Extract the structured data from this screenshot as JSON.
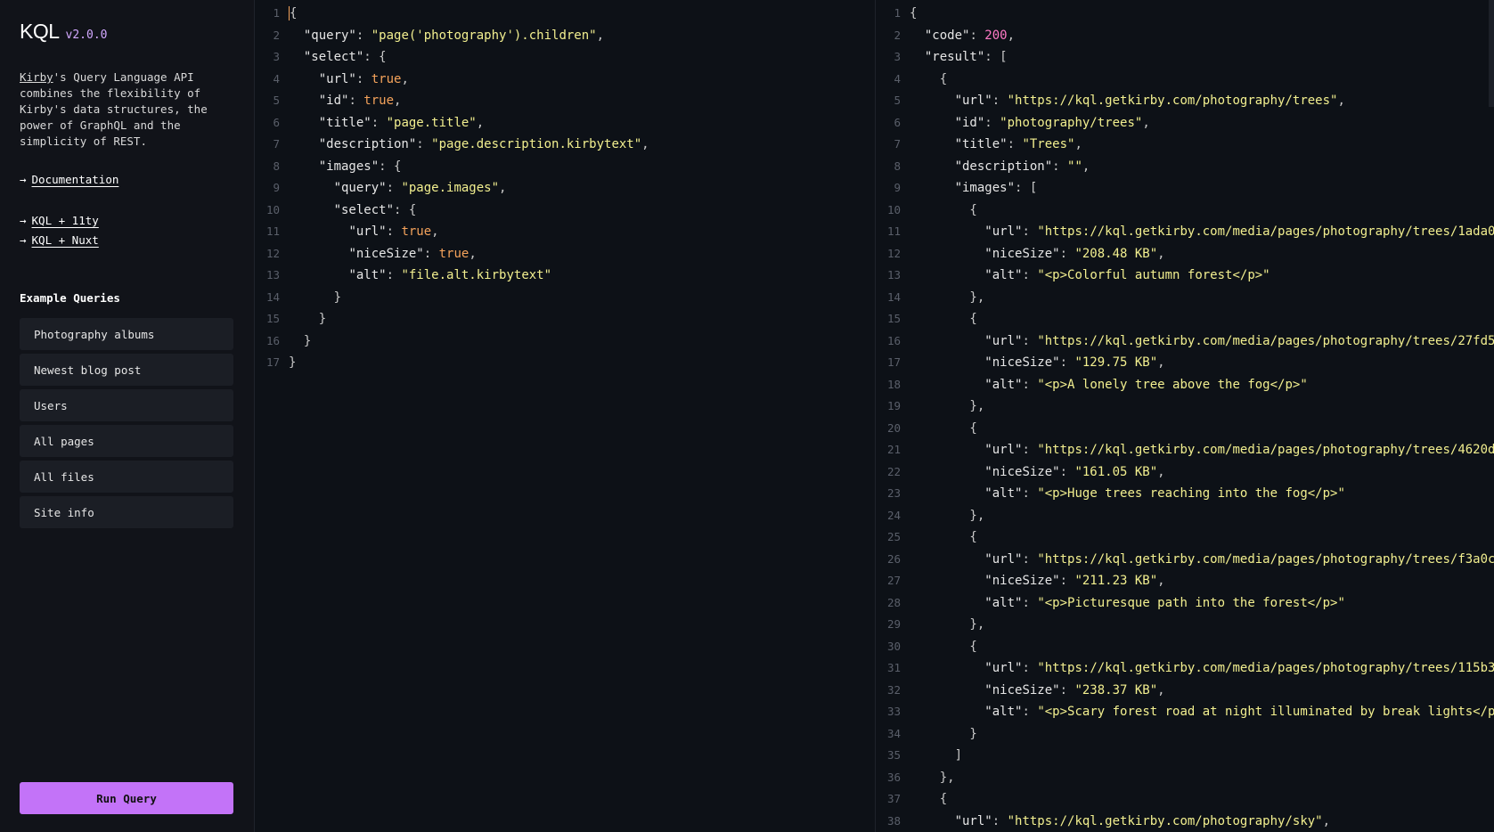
{
  "sidebar": {
    "brand_name": "KQL",
    "version": "v2.0.0",
    "intro_link": "Kirby",
    "intro_text": "'s Query Language API combines the flexibility of Kirby's data structures, the power of GraphQL and the simplicity of REST.",
    "links": [
      {
        "arrow": "→",
        "label": "Documentation"
      },
      {
        "arrow": "→",
        "label": "KQL + 11ty"
      },
      {
        "arrow": "→",
        "label": "KQL + Nuxt"
      }
    ],
    "examples_title": "Example Queries",
    "examples": [
      {
        "label": "Photography albums"
      },
      {
        "label": "Newest blog post"
      },
      {
        "label": "Users"
      },
      {
        "label": "All pages"
      },
      {
        "label": "All files"
      },
      {
        "label": "Site info"
      }
    ],
    "run_label": "Run Query"
  },
  "query_lines": [
    [
      {
        "t": "p",
        "v": "{"
      }
    ],
    [
      {
        "t": "p",
        "v": "  "
      },
      {
        "t": "k",
        "v": "\"query\""
      },
      {
        "t": "p",
        "v": ": "
      },
      {
        "t": "s",
        "v": "\"page('photography').children\""
      },
      {
        "t": "p",
        "v": ","
      }
    ],
    [
      {
        "t": "p",
        "v": "  "
      },
      {
        "t": "k",
        "v": "\"select\""
      },
      {
        "t": "p",
        "v": ": {"
      }
    ],
    [
      {
        "t": "p",
        "v": "    "
      },
      {
        "t": "k",
        "v": "\"url\""
      },
      {
        "t": "p",
        "v": ": "
      },
      {
        "t": "b",
        "v": "true"
      },
      {
        "t": "p",
        "v": ","
      }
    ],
    [
      {
        "t": "p",
        "v": "    "
      },
      {
        "t": "k",
        "v": "\"id\""
      },
      {
        "t": "p",
        "v": ": "
      },
      {
        "t": "b",
        "v": "true"
      },
      {
        "t": "p",
        "v": ","
      }
    ],
    [
      {
        "t": "p",
        "v": "    "
      },
      {
        "t": "k",
        "v": "\"title\""
      },
      {
        "t": "p",
        "v": ": "
      },
      {
        "t": "s",
        "v": "\"page.title\""
      },
      {
        "t": "p",
        "v": ","
      }
    ],
    [
      {
        "t": "p",
        "v": "    "
      },
      {
        "t": "k",
        "v": "\"description\""
      },
      {
        "t": "p",
        "v": ": "
      },
      {
        "t": "s",
        "v": "\"page.description.kirbytext\""
      },
      {
        "t": "p",
        "v": ","
      }
    ],
    [
      {
        "t": "p",
        "v": "    "
      },
      {
        "t": "k",
        "v": "\"images\""
      },
      {
        "t": "p",
        "v": ": {"
      }
    ],
    [
      {
        "t": "p",
        "v": "      "
      },
      {
        "t": "k",
        "v": "\"query\""
      },
      {
        "t": "p",
        "v": ": "
      },
      {
        "t": "s",
        "v": "\"page.images\""
      },
      {
        "t": "p",
        "v": ","
      }
    ],
    [
      {
        "t": "p",
        "v": "      "
      },
      {
        "t": "k",
        "v": "\"select\""
      },
      {
        "t": "p",
        "v": ": {"
      }
    ],
    [
      {
        "t": "p",
        "v": "        "
      },
      {
        "t": "k",
        "v": "\"url\""
      },
      {
        "t": "p",
        "v": ": "
      },
      {
        "t": "b",
        "v": "true"
      },
      {
        "t": "p",
        "v": ","
      }
    ],
    [
      {
        "t": "p",
        "v": "        "
      },
      {
        "t": "k",
        "v": "\"niceSize\""
      },
      {
        "t": "p",
        "v": ": "
      },
      {
        "t": "b",
        "v": "true"
      },
      {
        "t": "p",
        "v": ","
      }
    ],
    [
      {
        "t": "p",
        "v": "        "
      },
      {
        "t": "k",
        "v": "\"alt\""
      },
      {
        "t": "p",
        "v": ": "
      },
      {
        "t": "s",
        "v": "\"file.alt.kirbytext\""
      }
    ],
    [
      {
        "t": "p",
        "v": "      }"
      }
    ],
    [
      {
        "t": "p",
        "v": "    }"
      }
    ],
    [
      {
        "t": "p",
        "v": "  }"
      }
    ],
    [
      {
        "t": "p",
        "v": "}"
      }
    ]
  ],
  "result_lines": [
    [
      {
        "t": "p",
        "v": "{"
      }
    ],
    [
      {
        "t": "p",
        "v": "  "
      },
      {
        "t": "k",
        "v": "\"code\""
      },
      {
        "t": "p",
        "v": ": "
      },
      {
        "t": "n",
        "v": "200"
      },
      {
        "t": "p",
        "v": ","
      }
    ],
    [
      {
        "t": "p",
        "v": "  "
      },
      {
        "t": "k",
        "v": "\"result\""
      },
      {
        "t": "p",
        "v": ": ["
      }
    ],
    [
      {
        "t": "p",
        "v": "    {"
      }
    ],
    [
      {
        "t": "p",
        "v": "      "
      },
      {
        "t": "k",
        "v": "\"url\""
      },
      {
        "t": "p",
        "v": ": "
      },
      {
        "t": "s",
        "v": "\"https://kql.getkirby.com/photography/trees\""
      },
      {
        "t": "p",
        "v": ","
      }
    ],
    [
      {
        "t": "p",
        "v": "      "
      },
      {
        "t": "k",
        "v": "\"id\""
      },
      {
        "t": "p",
        "v": ": "
      },
      {
        "t": "s",
        "v": "\"photography/trees\""
      },
      {
        "t": "p",
        "v": ","
      }
    ],
    [
      {
        "t": "p",
        "v": "      "
      },
      {
        "t": "k",
        "v": "\"title\""
      },
      {
        "t": "p",
        "v": ": "
      },
      {
        "t": "s",
        "v": "\"Trees\""
      },
      {
        "t": "p",
        "v": ","
      }
    ],
    [
      {
        "t": "p",
        "v": "      "
      },
      {
        "t": "k",
        "v": "\"description\""
      },
      {
        "t": "p",
        "v": ": "
      },
      {
        "t": "s",
        "v": "\"\""
      },
      {
        "t": "p",
        "v": ","
      }
    ],
    [
      {
        "t": "p",
        "v": "      "
      },
      {
        "t": "k",
        "v": "\"images\""
      },
      {
        "t": "p",
        "v": ": ["
      }
    ],
    [
      {
        "t": "p",
        "v": "        {"
      }
    ],
    [
      {
        "t": "p",
        "v": "          "
      },
      {
        "t": "k",
        "v": "\"url\""
      },
      {
        "t": "p",
        "v": ": "
      },
      {
        "t": "s",
        "v": "\"https://kql.getkirby.com/media/pages/photography/trees/1ada0"
      }
    ],
    [
      {
        "t": "p",
        "v": "          "
      },
      {
        "t": "k",
        "v": "\"niceSize\""
      },
      {
        "t": "p",
        "v": ": "
      },
      {
        "t": "s",
        "v": "\"208.48 KB\""
      },
      {
        "t": "p",
        "v": ","
      }
    ],
    [
      {
        "t": "p",
        "v": "          "
      },
      {
        "t": "k",
        "v": "\"alt\""
      },
      {
        "t": "p",
        "v": ": "
      },
      {
        "t": "s",
        "v": "\"<p>Colorful autumn forest</p>\""
      }
    ],
    [
      {
        "t": "p",
        "v": "        },"
      }
    ],
    [
      {
        "t": "p",
        "v": "        {"
      }
    ],
    [
      {
        "t": "p",
        "v": "          "
      },
      {
        "t": "k",
        "v": "\"url\""
      },
      {
        "t": "p",
        "v": ": "
      },
      {
        "t": "s",
        "v": "\"https://kql.getkirby.com/media/pages/photography/trees/27fd5"
      }
    ],
    [
      {
        "t": "p",
        "v": "          "
      },
      {
        "t": "k",
        "v": "\"niceSize\""
      },
      {
        "t": "p",
        "v": ": "
      },
      {
        "t": "s",
        "v": "\"129.75 KB\""
      },
      {
        "t": "p",
        "v": ","
      }
    ],
    [
      {
        "t": "p",
        "v": "          "
      },
      {
        "t": "k",
        "v": "\"alt\""
      },
      {
        "t": "p",
        "v": ": "
      },
      {
        "t": "s",
        "v": "\"<p>A lonely tree above the fog</p>\""
      }
    ],
    [
      {
        "t": "p",
        "v": "        },"
      }
    ],
    [
      {
        "t": "p",
        "v": "        {"
      }
    ],
    [
      {
        "t": "p",
        "v": "          "
      },
      {
        "t": "k",
        "v": "\"url\""
      },
      {
        "t": "p",
        "v": ": "
      },
      {
        "t": "s",
        "v": "\"https://kql.getkirby.com/media/pages/photography/trees/4620d"
      }
    ],
    [
      {
        "t": "p",
        "v": "          "
      },
      {
        "t": "k",
        "v": "\"niceSize\""
      },
      {
        "t": "p",
        "v": ": "
      },
      {
        "t": "s",
        "v": "\"161.05 KB\""
      },
      {
        "t": "p",
        "v": ","
      }
    ],
    [
      {
        "t": "p",
        "v": "          "
      },
      {
        "t": "k",
        "v": "\"alt\""
      },
      {
        "t": "p",
        "v": ": "
      },
      {
        "t": "s",
        "v": "\"<p>Huge trees reaching into the fog</p>\""
      }
    ],
    [
      {
        "t": "p",
        "v": "        },"
      }
    ],
    [
      {
        "t": "p",
        "v": "        {"
      }
    ],
    [
      {
        "t": "p",
        "v": "          "
      },
      {
        "t": "k",
        "v": "\"url\""
      },
      {
        "t": "p",
        "v": ": "
      },
      {
        "t": "s",
        "v": "\"https://kql.getkirby.com/media/pages/photography/trees/f3a0c"
      }
    ],
    [
      {
        "t": "p",
        "v": "          "
      },
      {
        "t": "k",
        "v": "\"niceSize\""
      },
      {
        "t": "p",
        "v": ": "
      },
      {
        "t": "s",
        "v": "\"211.23 KB\""
      },
      {
        "t": "p",
        "v": ","
      }
    ],
    [
      {
        "t": "p",
        "v": "          "
      },
      {
        "t": "k",
        "v": "\"alt\""
      },
      {
        "t": "p",
        "v": ": "
      },
      {
        "t": "s",
        "v": "\"<p>Picturesque path into the forest</p>\""
      }
    ],
    [
      {
        "t": "p",
        "v": "        },"
      }
    ],
    [
      {
        "t": "p",
        "v": "        {"
      }
    ],
    [
      {
        "t": "p",
        "v": "          "
      },
      {
        "t": "k",
        "v": "\"url\""
      },
      {
        "t": "p",
        "v": ": "
      },
      {
        "t": "s",
        "v": "\"https://kql.getkirby.com/media/pages/photography/trees/115b3"
      }
    ],
    [
      {
        "t": "p",
        "v": "          "
      },
      {
        "t": "k",
        "v": "\"niceSize\""
      },
      {
        "t": "p",
        "v": ": "
      },
      {
        "t": "s",
        "v": "\"238.37 KB\""
      },
      {
        "t": "p",
        "v": ","
      }
    ],
    [
      {
        "t": "p",
        "v": "          "
      },
      {
        "t": "k",
        "v": "\"alt\""
      },
      {
        "t": "p",
        "v": ": "
      },
      {
        "t": "s",
        "v": "\"<p>Scary forest road at night illuminated by break lights</p"
      }
    ],
    [
      {
        "t": "p",
        "v": "        }"
      }
    ],
    [
      {
        "t": "p",
        "v": "      ]"
      }
    ],
    [
      {
        "t": "p",
        "v": "    },"
      }
    ],
    [
      {
        "t": "p",
        "v": "    {"
      }
    ],
    [
      {
        "t": "p",
        "v": "      "
      },
      {
        "t": "k",
        "v": "\"url\""
      },
      {
        "t": "p",
        "v": ": "
      },
      {
        "t": "s",
        "v": "\"https://kql.getkirby.com/photography/sky\""
      },
      {
        "t": "p",
        "v": ","
      }
    ]
  ]
}
